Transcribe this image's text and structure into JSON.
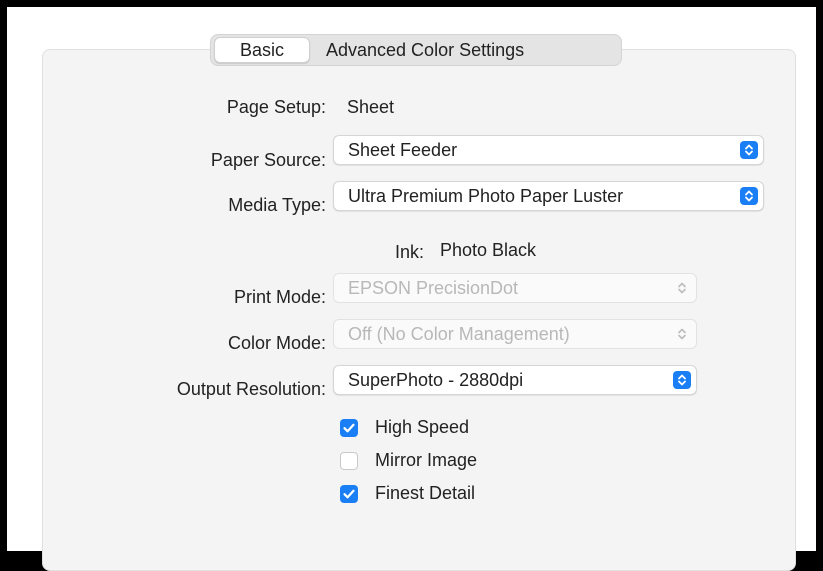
{
  "tabs": {
    "basic": "Basic",
    "advanced": "Advanced Color Settings"
  },
  "fields": {
    "page_setup": {
      "label": "Page Setup:",
      "value": "Sheet"
    },
    "paper_source": {
      "label": "Paper Source:",
      "value": "Sheet Feeder"
    },
    "media_type": {
      "label": "Media Type:",
      "value": "Ultra Premium Photo Paper Luster"
    },
    "ink": {
      "label": "Ink:",
      "value": "Photo Black"
    },
    "print_mode": {
      "label": "Print Mode:",
      "value": "EPSON PrecisionDot"
    },
    "color_mode": {
      "label": "Color Mode:",
      "value": "Off (No Color Management)"
    },
    "output_resolution": {
      "label": "Output Resolution:",
      "value": "SuperPhoto - 2880dpi"
    }
  },
  "checkboxes": {
    "high_speed": {
      "label": "High Speed",
      "checked": true
    },
    "mirror_image": {
      "label": "Mirror Image",
      "checked": false
    },
    "finest_detail": {
      "label": "Finest Detail",
      "checked": true
    }
  },
  "colors": {
    "accent": "#1a7ff5"
  },
  "icons": {
    "stepper": "chevron-up-down-icon",
    "check": "checkmark-icon"
  }
}
